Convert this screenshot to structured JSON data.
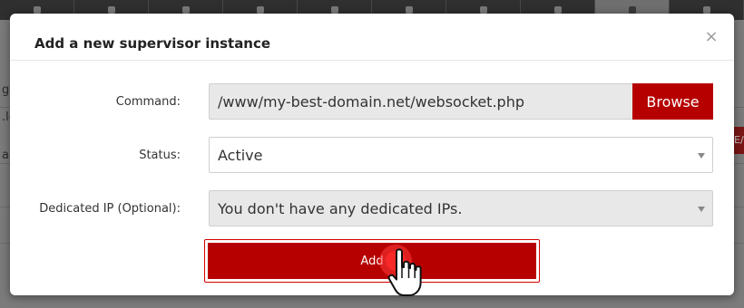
{
  "modal": {
    "title": "Add a new supervisor instance",
    "close_symbol": "×",
    "command": {
      "label": "Command:",
      "value": "/www/my-best-domain.net/websocket.php",
      "browse_label": "Browse"
    },
    "status": {
      "label": "Status:",
      "selected": "Active"
    },
    "dedicated_ip": {
      "label": "Dedicated IP (Optional):",
      "selected": "You don't have any dedicated IPs."
    },
    "add_label": "Add"
  },
  "background": {
    "fragments": [
      "gı",
      ".lo",
      "a"
    ],
    "button_fragment": "E/"
  },
  "colors": {
    "accent": "#b60000",
    "overlay_bg": "#5d5d5d"
  },
  "icons": [
    "close-icon",
    "caret-down-icon",
    "pointer-hand-icon"
  ]
}
